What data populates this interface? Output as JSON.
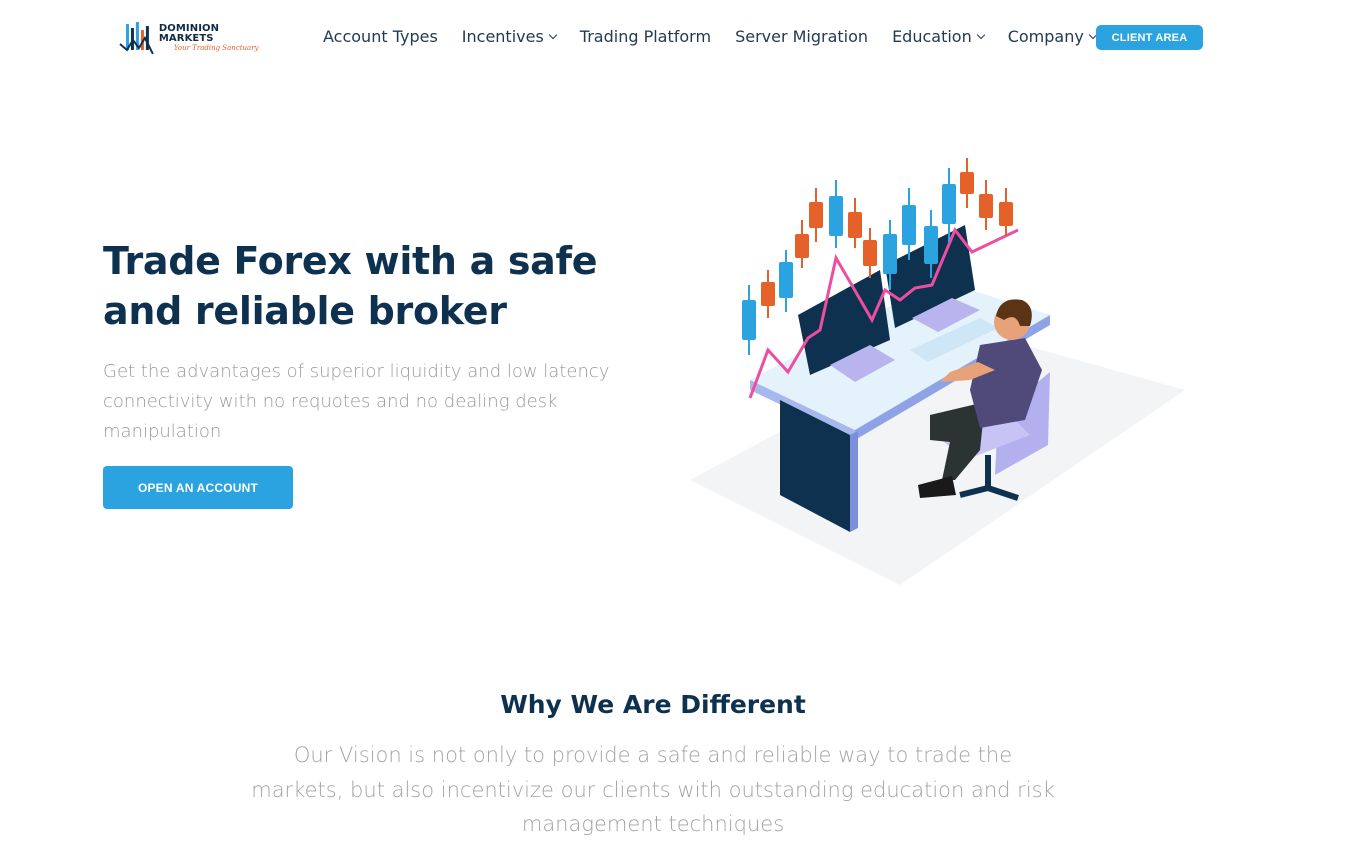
{
  "brand": {
    "name": "DOMINION MARKETS",
    "tagline": "Your Trading Sanctuary",
    "colors": {
      "navy": "#0f3150",
      "accent_blue": "#2aa3e0",
      "orange": "#e5612a",
      "pink": "#ec4ea0"
    }
  },
  "nav": {
    "items": [
      {
        "label": "Account Types",
        "dropdown": false
      },
      {
        "label": "Incentives",
        "dropdown": true
      },
      {
        "label": "Trading Platform",
        "dropdown": false
      },
      {
        "label": "Server Migration",
        "dropdown": false
      },
      {
        "label": "Education",
        "dropdown": true
      },
      {
        "label": "Company",
        "dropdown": true
      }
    ],
    "client_area_label": "CLIENT AREA"
  },
  "hero": {
    "title": "Trade Forex with a safe and reliable broker",
    "subtitle": "Get the advantages of superior liquidity and low latency connectivity with no requotes and no dealing desk manipulation",
    "cta_label": "OPEN AN ACCOUNT",
    "illustration_icon": "trader-at-desk-illustration"
  },
  "why": {
    "title": "Why We Are Different",
    "text": "Our Vision is not only to provide a safe and reliable way to trade the markets, but also incentivize our clients with outstanding education and risk management techniques"
  }
}
